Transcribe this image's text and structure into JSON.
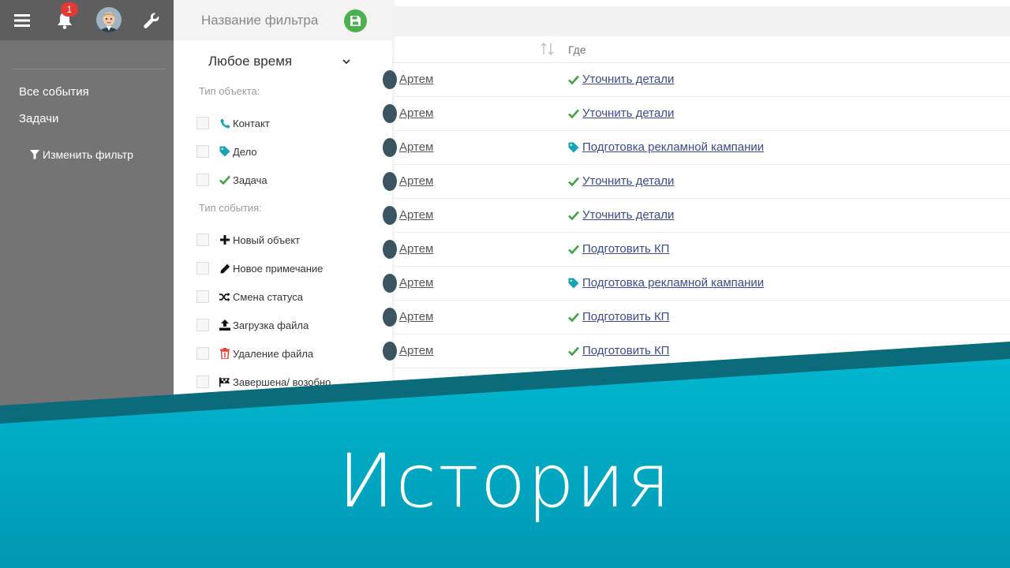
{
  "topbar": {
    "notification_count": "1"
  },
  "sidebar": {
    "items": [
      {
        "label": "Все события"
      },
      {
        "label": "Задачи"
      }
    ],
    "edit_filter_label": "Изменить фильтр"
  },
  "filter_panel": {
    "name_placeholder": "Название фильтра",
    "time_value": "Любое время",
    "object_type_label": "Тип объекта:",
    "object_types": [
      {
        "label": "Контакт",
        "icon": "phone-icon",
        "color": "#1aa3b5"
      },
      {
        "label": "Дело",
        "icon": "tag-icon",
        "color": "#1aa3b5"
      },
      {
        "label": "Задача",
        "icon": "check-icon",
        "color": "#43a047"
      }
    ],
    "event_type_label": "Тип события:",
    "event_types": [
      {
        "label": "Новый объект",
        "icon": "plus-icon"
      },
      {
        "label": "Новое примечание",
        "icon": "pencil-icon"
      },
      {
        "label": "Смена статуса",
        "icon": "shuffle-icon"
      },
      {
        "label": "Загрузка файла",
        "icon": "upload-icon"
      },
      {
        "label": "Удаление файла",
        "icon": "trash-icon",
        "color": "#e53935"
      },
      {
        "label": "Завершена/ возобно",
        "icon": "flag-icon"
      }
    ]
  },
  "table": {
    "col_where": "Где",
    "rows": [
      {
        "who": "Артем",
        "where": "Уточнить детали",
        "icon": "check-icon"
      },
      {
        "who": "Артем",
        "where": "Уточнить детали",
        "icon": "check-icon"
      },
      {
        "who": "Артем",
        "where": "Подготовка рекламной кампании",
        "icon": "tag-icon"
      },
      {
        "who": "Артем",
        "where": "Уточнить детали",
        "icon": "check-icon"
      },
      {
        "who": "Артем",
        "where": "Уточнить детали",
        "icon": "check-icon"
      },
      {
        "who": "Артем",
        "where": "Подготовить КП",
        "icon": "check-icon"
      },
      {
        "who": "Артем",
        "where": "Подготовка рекламной кампании",
        "icon": "tag-icon"
      },
      {
        "who": "Артем",
        "where": "Подготовить КП",
        "icon": "check-icon"
      },
      {
        "who": "Артем",
        "where": "Подготовить КП",
        "icon": "check-icon"
      }
    ]
  },
  "banner": {
    "title": "История",
    "color_dark": "#0a6b7a",
    "color_light": "#00a9c2"
  }
}
